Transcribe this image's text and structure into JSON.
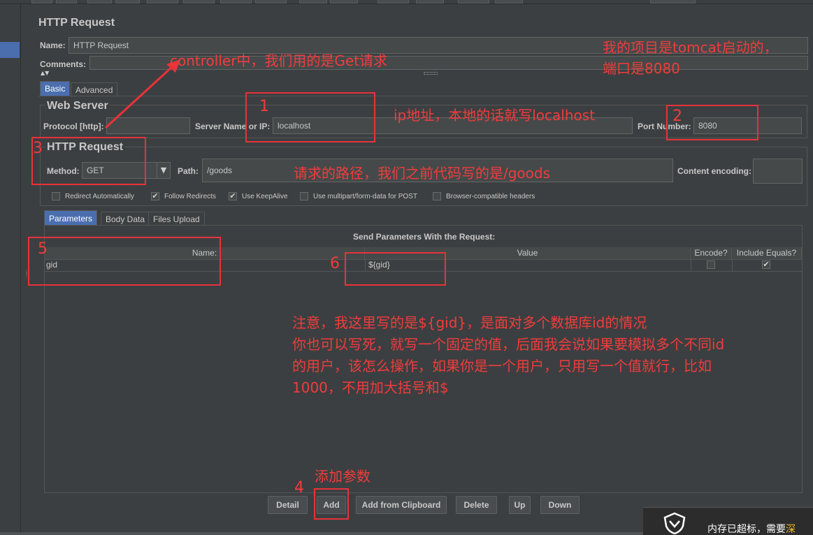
{
  "panel": {
    "title": "HTTP Request",
    "name_label": "Name:",
    "name_value": "HTTP Request",
    "comments_label": "Comments:"
  },
  "tabs": {
    "basic": "Basic",
    "advanced": "Advanced"
  },
  "web_server": {
    "title": "Web Server",
    "protocol_label": "Protocol [http]:",
    "protocol_value": "",
    "server_label": "Server Name or IP:",
    "server_value": "localhost",
    "port_label": "Port Number:",
    "port_value": "8080"
  },
  "http_request": {
    "title": "HTTP Request",
    "method_label": "Method:",
    "method_value": "GET",
    "path_label": "Path:",
    "path_value": "/goods",
    "encoding_label": "Content encoding:",
    "encoding_value": ""
  },
  "options": [
    {
      "label": "Redirect Automatically",
      "checked": false
    },
    {
      "label": "Follow Redirects",
      "checked": true
    },
    {
      "label": "Use KeepAlive",
      "checked": true
    },
    {
      "label": "Use multipart/form-data for POST",
      "checked": false
    },
    {
      "label": "Browser-compatible headers",
      "checked": false
    }
  ],
  "param_tabs": {
    "parameters": "Parameters",
    "body_data": "Body Data",
    "files_upload": "Files Upload"
  },
  "params_table": {
    "caption": "Send Parameters With the Request:",
    "columns": [
      "Name:",
      "Value",
      "Encode?",
      "Include Equals?"
    ],
    "rows": [
      {
        "name": "gid",
        "value": "${gid}",
        "encode": false,
        "include_equals": true
      }
    ]
  },
  "buttons": {
    "detail": "Detail",
    "add": "Add",
    "add_clipboard": "Add from Clipboard",
    "delete": "Delete",
    "up": "Up",
    "down": "Down"
  },
  "annotations": {
    "get_note": "controller中，我们用的是Get请求",
    "tomcat_line1": "我的项目是tomcat启动的，",
    "tomcat_line2": "端口是8080",
    "ip_note": "ip地址，本地的话就写localhost",
    "path_note": "请求的路径，我们之前代码写的是/goods",
    "n1": "1",
    "n2": "2",
    "n3": "3",
    "n4": "4",
    "n5": "5",
    "n6": "6",
    "notice_lines": [
      "注意，我这里写的是${gid}，是面对多个数据库id的情况",
      "你也可以写死，就写一个固定的值，后面我会说如果要模拟多个不同id",
      "的用户，该怎么操作，如果你是一个用户，只用写一个值就行，比如",
      "1000，不用加大括号和$"
    ],
    "add_param": "添加参数"
  },
  "popup": {
    "text_normal": "内存已超标，需要",
    "text_highlight": "深"
  },
  "icons": {
    "method_dropdown": "chevron-down-icon",
    "popup_shield": "shield-icon",
    "annotation_arrow": "arrow-icon"
  },
  "colors": {
    "annotation": "#e8323a",
    "selected_tab": "#4b6eaf",
    "background": "#3c3f41"
  }
}
